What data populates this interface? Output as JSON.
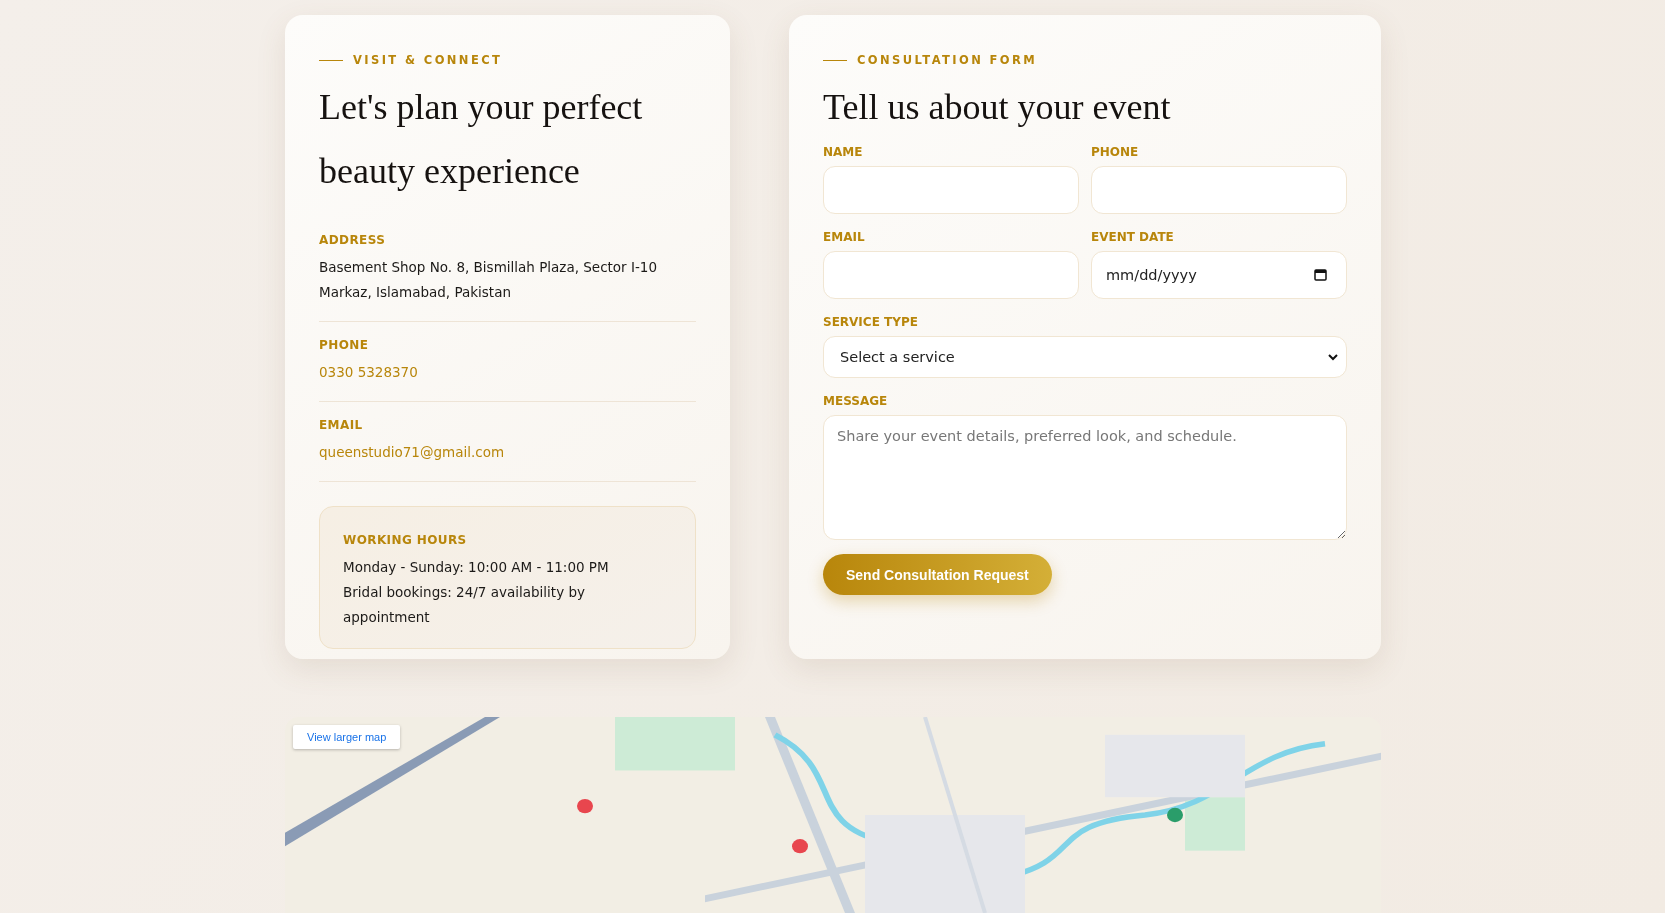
{
  "contact": {
    "eyebrow": "VISIT & CONNECT",
    "heading": "Let's plan your perfect beauty experience",
    "details": [
      {
        "kind": "text",
        "label": "ADDRESS",
        "value": "Basement Shop No. 8, Bismillah Plaza, Sector I-10 Markaz, Islamabad, Pakistan"
      },
      {
        "kind": "link",
        "label": "PHONE",
        "value": "0330 5328370"
      },
      {
        "kind": "link",
        "label": "EMAIL",
        "value": "queenstudio71@gmail.com"
      }
    ],
    "hours": {
      "title": "WORKING HOURS",
      "lines": [
        "Monday - Sunday: 10:00 AM - 11:00 PM",
        "Bridal bookings: 24/7 availability by appointment"
      ]
    }
  },
  "form": {
    "eyebrow": "CONSULTATION FORM",
    "heading": "Tell us about your event",
    "fields": [
      {
        "kind": "text",
        "label": "NAME"
      },
      {
        "kind": "text",
        "label": "PHONE"
      },
      {
        "kind": "text",
        "label": "EMAIL"
      },
      {
        "kind": "date",
        "label": "EVENT DATE",
        "placeholder": "mm/dd/yyyy"
      },
      {
        "kind": "select",
        "label": "SERVICE TYPE",
        "value": "Select a service"
      },
      {
        "kind": "textarea",
        "label": "MESSAGE",
        "placeholder": "Share your event details, preferred look, and schedule."
      }
    ],
    "submit": "Send Consultation Request"
  },
  "map": {
    "kind": "picture",
    "link": "View larger map"
  }
}
